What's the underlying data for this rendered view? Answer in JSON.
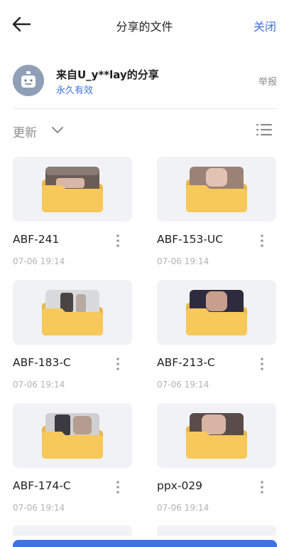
{
  "header": {
    "title": "分享的文件",
    "close_label": "关闭",
    "back_icon": "arrow-left-icon"
  },
  "sharer": {
    "name": "来自U_y**lay的分享",
    "validity": "永久有效",
    "report_label": "举报"
  },
  "sort": {
    "label": "更新",
    "chevron_icon": "chevron-down-icon",
    "view_icon": "list-view-icon"
  },
  "files": [
    {
      "name": "ABF-241",
      "date": "07-06 19:14"
    },
    {
      "name": "ABF-153-UC",
      "date": "07-06 19:14"
    },
    {
      "name": "ABF-183-C",
      "date": "07-06 19:14"
    },
    {
      "name": "ABF-213-C",
      "date": "07-06 19:14"
    },
    {
      "name": "ABF-174-C",
      "date": "07-06 19:14"
    },
    {
      "name": "ppx-029",
      "date": "07-06 19:14"
    }
  ],
  "colors": {
    "accent": "#3f72e4",
    "folder": "#f7c85a",
    "thumb_bg": "#f1f2f5"
  }
}
